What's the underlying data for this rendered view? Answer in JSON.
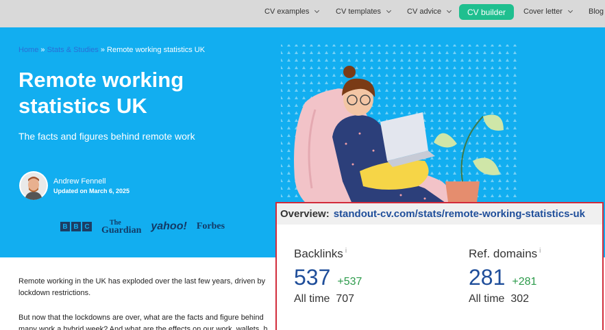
{
  "nav": {
    "items": [
      {
        "label": "CV examples",
        "has_dropdown": true
      },
      {
        "label": "CV templates",
        "has_dropdown": true
      },
      {
        "label": "CV advice",
        "has_dropdown": true
      },
      {
        "label": "Cover letter",
        "has_dropdown": true
      },
      {
        "label": "Blog",
        "has_dropdown": false
      }
    ],
    "cta_label": "CV builder",
    "cta_color": "#1fbf8f"
  },
  "hero": {
    "breadcrumb": {
      "home": "Home",
      "sep": " » ",
      "section": "Stats & Studies",
      "current": "Remote working statistics UK"
    },
    "title": "Remote working statistics UK",
    "subtitle": "The facts and figures behind remote work",
    "author": {
      "name": "Andrew Fennell",
      "updated": "Updated on March 6, 2025"
    },
    "press_logos": {
      "bbc": [
        "B",
        "B",
        "C"
      ],
      "guardian": [
        "The",
        "Guardian"
      ],
      "yahoo": "yahoo!",
      "forbes": "Forbes"
    },
    "background_color": "#12aef0"
  },
  "body": {
    "paragraph_1_line_1": "Remote working in the UK has exploded over the last few years, driven by",
    "paragraph_1_line_2": "lockdown restrictions.",
    "paragraph_2_line_1": "But now that the lockdowns are over, what are the facts and figure behind",
    "paragraph_2_line_2": "many work a hybrid week? And what are the effects on our work, wallets, h"
  },
  "overview": {
    "label": "Overview:",
    "url": "standout-cv.com/stats/remote-working-statistics-uk",
    "backlinks": {
      "label": "Backlinks",
      "info": "i",
      "value": "537",
      "delta": "+537",
      "all_time_label": "All time",
      "all_time_value": "707"
    },
    "ref_domains": {
      "label": "Ref. domains",
      "info": "i",
      "value": "281",
      "delta": "+281",
      "all_time_label": "All time",
      "all_time_value": "302"
    },
    "border_color": "#d22a3a",
    "value_color": "#1f4e9a",
    "delta_color": "#2b9a4a"
  }
}
